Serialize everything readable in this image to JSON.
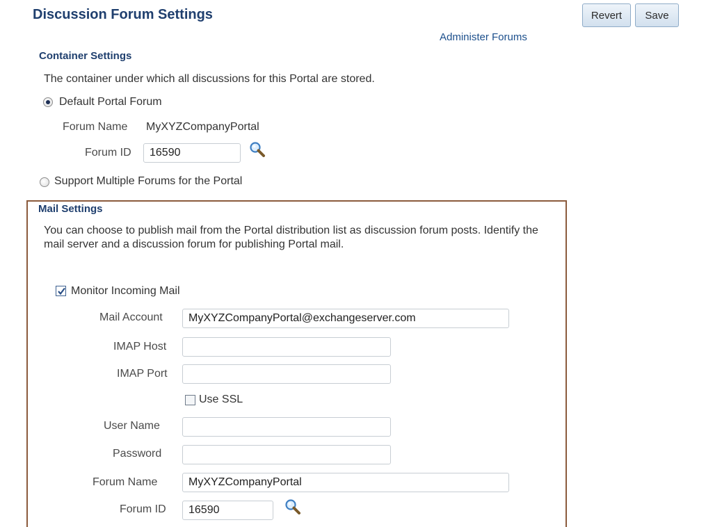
{
  "header": {
    "title": "Discussion Forum Settings",
    "revert_label": "Revert",
    "save_label": "Save",
    "administer_link": "Administer Forums"
  },
  "container_settings": {
    "title": "Container Settings",
    "description": "The container under which all discussions for this Portal are stored.",
    "option_default": "Default Portal Forum",
    "forum_name_label": "Forum Name",
    "forum_name_value": "MyXYZCompanyPortal",
    "forum_id_label": "Forum ID",
    "forum_id_value": "16590",
    "option_multiple": "Support Multiple Forums for the Portal",
    "selected_option": "Default Portal Forum"
  },
  "mail_settings": {
    "title": "Mail Settings",
    "description": "You can choose to publish mail from the Portal distribution list as discussion forum posts. Identify the mail server and a discussion forum for publishing Portal mail.",
    "monitor_label": "Monitor Incoming Mail",
    "monitor_checked": true,
    "mail_account_label": "Mail Account",
    "mail_account_value": "MyXYZCompanyPortal@exchangeserver.com",
    "imap_host_label": "IMAP Host",
    "imap_host_value": "",
    "imap_port_label": "IMAP Port",
    "imap_port_value": "",
    "use_ssl_label": "Use SSL",
    "use_ssl_checked": false,
    "user_name_label": "User Name",
    "user_name_value": "",
    "password_label": "Password",
    "password_value": "",
    "forum_name_label": "Forum Name",
    "forum_name_value": "MyXYZCompanyPortal",
    "forum_id_label": "Forum ID",
    "forum_id_value": "16590"
  },
  "icons": {
    "search": "search-icon",
    "radio": "radio-icon",
    "checkbox": "checkbox-icon"
  },
  "colors": {
    "title_blue": "#1f3f6e",
    "link_blue": "#1c4f8c",
    "mail_box_border": "#8b5a3c"
  }
}
